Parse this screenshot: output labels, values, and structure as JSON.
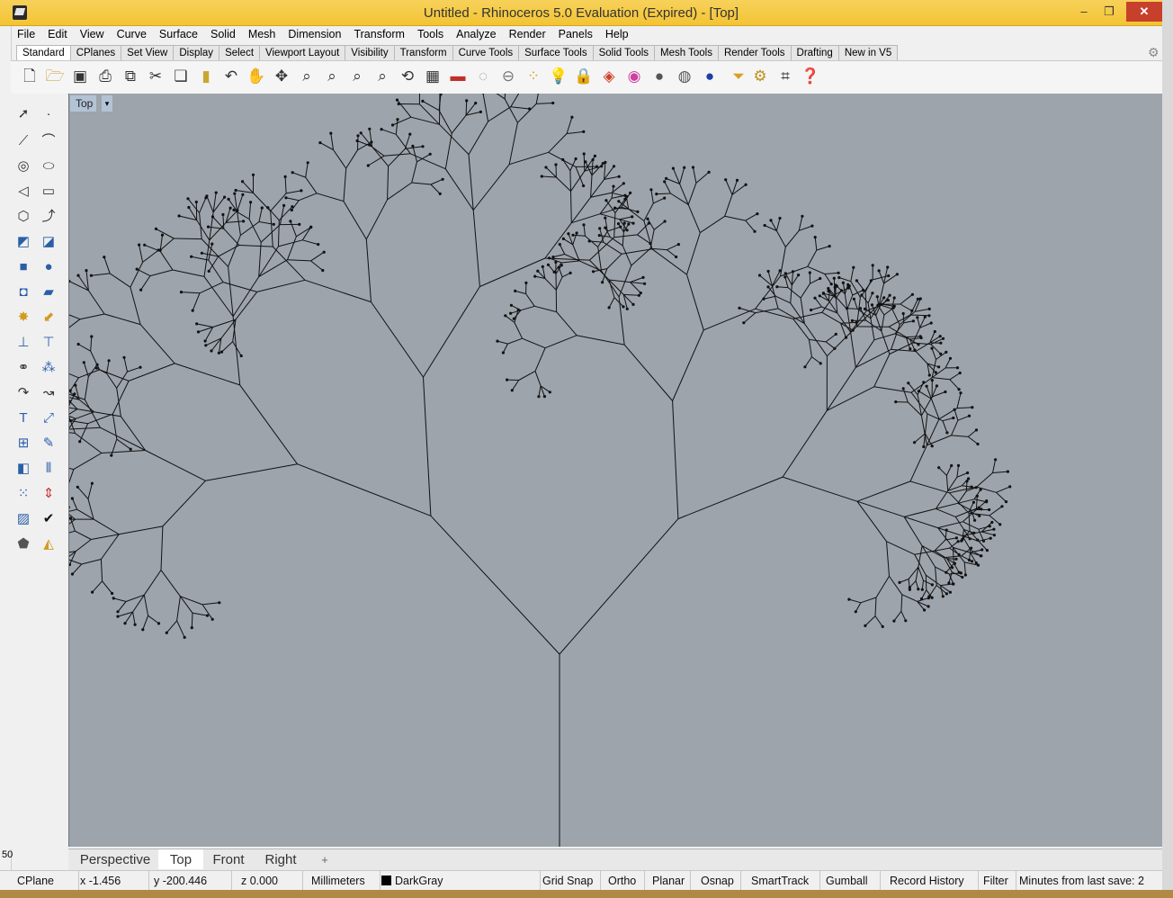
{
  "window": {
    "title": "Untitled - Rhinoceros 5.0 Evaluation (Expired) - [Top]",
    "min": "–",
    "max": "❐",
    "close": "✕"
  },
  "menu": [
    "File",
    "Edit",
    "View",
    "Curve",
    "Surface",
    "Solid",
    "Mesh",
    "Dimension",
    "Transform",
    "Tools",
    "Analyze",
    "Render",
    "Panels",
    "Help"
  ],
  "toolbar_tabs": [
    "Standard",
    "CPlanes",
    "Set View",
    "Display",
    "Select",
    "Viewport Layout",
    "Visibility",
    "Transform",
    "Curve Tools",
    "Surface Tools",
    "Solid Tools",
    "Mesh Tools",
    "Render Tools",
    "Drafting",
    "New in V5"
  ],
  "toolbar_icons": [
    "new-file-icon",
    "open-file-icon",
    "save-icon",
    "print-icon",
    "import-icon",
    "cut-icon",
    "copy-icon",
    "paste-icon",
    "undo-icon",
    "pan-hand-icon",
    "rotate-view-icon",
    "zoom-icon",
    "zoom-window-icon",
    "zoom-extents-icon",
    "zoom-selected-icon",
    "undo-view-icon",
    "four-viewports-icon",
    "car-render-icon",
    "hide-icon",
    "show-icon",
    "points-on-icon",
    "light-icon",
    "lock-icon",
    "layers-icon",
    "color-wheel-icon",
    "shaded-sphere-icon",
    "rendered-sphere-icon",
    "blue-sphere-icon",
    "selection-filter-icon",
    "options-gear-icon",
    "osnap-icon",
    "help-icon"
  ],
  "viewport": {
    "name": "Top",
    "menu_arrow": "▾"
  },
  "viewport_tabs": [
    "Perspective",
    "Top",
    "Front",
    "Right",
    "+"
  ],
  "status": {
    "cplane": "CPlane",
    "x": "x -1.456",
    "y": "y -200.446",
    "z": "z 0.000",
    "units": "Millimeters",
    "layer": "DarkGray",
    "grid_snap": "Grid Snap",
    "ortho": "Ortho",
    "planar": "Planar",
    "osnap": "Osnap",
    "smarttrack": "SmartTrack",
    "gumball": "Gumball",
    "record_history": "Record History",
    "filter": "Filter",
    "save_info": "Minutes from last save: 2"
  },
  "side_text": "50"
}
